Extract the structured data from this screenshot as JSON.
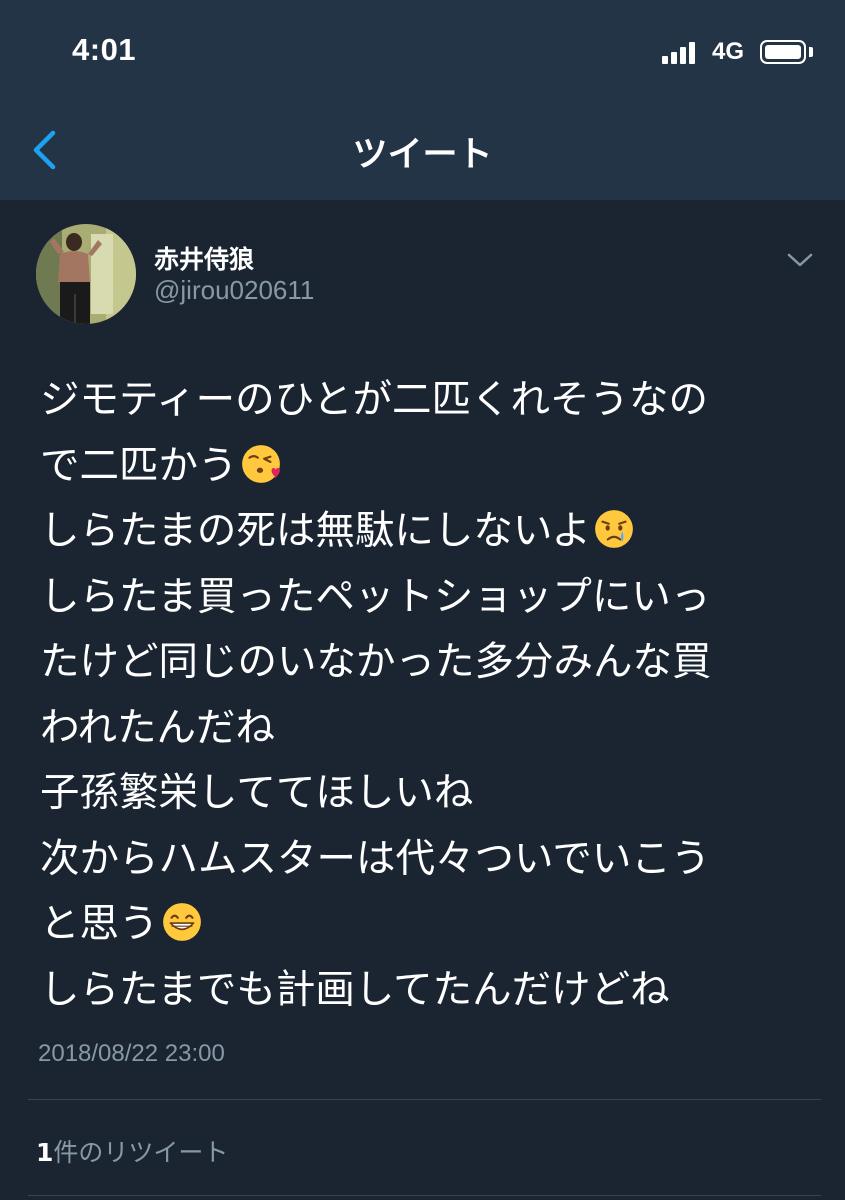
{
  "status_bar": {
    "time": "4:01",
    "network": "4G"
  },
  "header": {
    "title": "ツイート"
  },
  "tweet": {
    "display_name": "赤井侍狼",
    "handle": "@jirou020611",
    "lines": [
      "ジモティーのひとが二匹くれそうなの",
      "で二匹かう",
      "しらたまの死は無駄にしないよ",
      "しらたま買ったペットショップにいっ",
      "たけど同じのいなかった多分みんな買",
      "われたんだね",
      "子孫繁栄しててほしいね",
      "次からハムスターは代々ついでいこう",
      "と思う",
      "しらたまでも計画してたんだけどね"
    ],
    "emojis": {
      "kiss": "kissing-heart-emoji",
      "cry": "crying-face-emoji",
      "grin": "grinning-face-emoji"
    },
    "timestamp": "2018/08/22 23:00",
    "retweets": {
      "count": "1",
      "label": "件のリツイート"
    }
  },
  "colors": {
    "background": "#1b2532",
    "header_background": "#243447",
    "accent": "#1da1f2",
    "secondary_text": "#8899a6",
    "divider": "#38444d"
  }
}
